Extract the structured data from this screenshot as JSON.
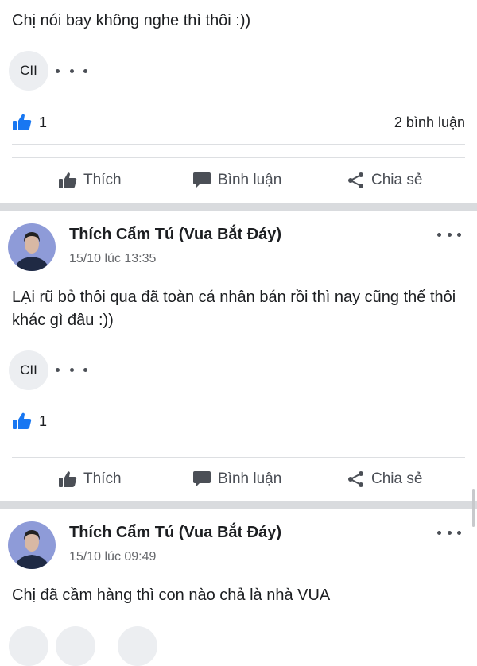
{
  "posts": [
    {
      "text": "Chị nói bay không nghe thì thôi :))",
      "chip": "CII",
      "likes": "1",
      "comments": "2 bình luận"
    },
    {
      "author": "Thích Cẩm Tú (Vua Bắt Đáy)",
      "time": "15/10 lúc 13:35",
      "text": "LẠi rũ bỏ thôi qua đã toàn cá nhân bán rồi thì nay cũng thế thôi khác gì đâu :))",
      "chip": "CII",
      "likes": "1"
    },
    {
      "author": "Thích Cẩm Tú (Vua Bắt Đáy)",
      "time": "15/10 lúc 09:49",
      "text": "Chị đã cầm hàng thì con nào chả là nhà VUA"
    }
  ],
  "actions": {
    "like": "Thích",
    "comment": "Bình luận",
    "share": "Chia sẻ"
  },
  "icons": {
    "like": "thumbs-up-icon",
    "comment": "speech-bubble-icon",
    "share": "share-icon",
    "more": "more-dots-icon"
  },
  "colors": {
    "like_blue": "#1877f2",
    "action_gray": "#4b4f56",
    "separator": "#d9dbde"
  }
}
